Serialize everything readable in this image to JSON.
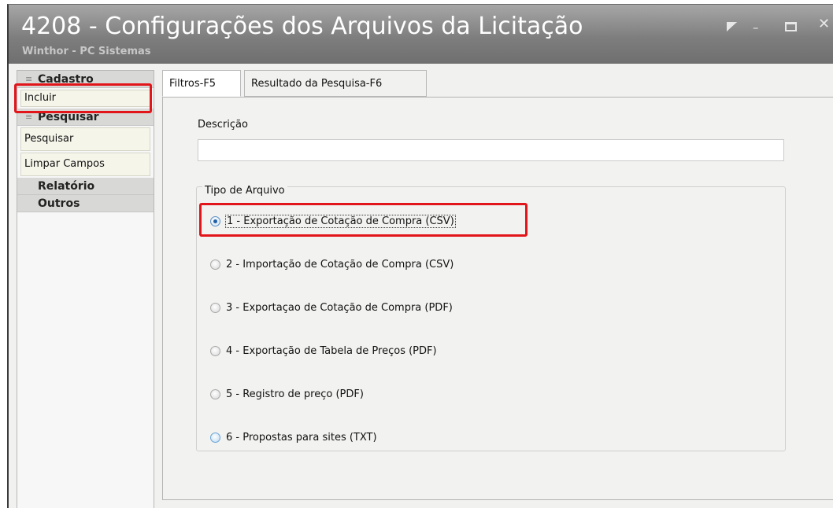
{
  "window": {
    "title": "4208 - Configurações dos Arquivos da Licitação",
    "subtitle": "Winthor - PC Sistemas"
  },
  "sidebar": {
    "groups": [
      {
        "label": "Cadastro",
        "items": [
          {
            "label": "Incluir"
          }
        ]
      },
      {
        "label": "Pesquisar",
        "items": [
          {
            "label": "Pesquisar"
          },
          {
            "label": "Limpar Campos"
          }
        ]
      },
      {
        "label": "Relatório"
      },
      {
        "label": "Outros"
      }
    ]
  },
  "tabs": [
    {
      "label": "Filtros-F5",
      "active": true
    },
    {
      "label": "Resultado da Pesquisa-F6",
      "active": false
    }
  ],
  "filters": {
    "description_label": "Descrição",
    "description_value": "",
    "file_type_label": "Tipo de Arquivo",
    "file_types": [
      {
        "label": "1 - Exportação de Cotação de Compra (CSV)",
        "selected": true
      },
      {
        "label": "2 - Importação de Cotação de Compra (CSV)",
        "selected": false
      },
      {
        "label": "3 - Exportaçao de Cotação de Compra (PDF)",
        "selected": false
      },
      {
        "label": "4 - Exportação de Tabela de Preços (PDF)",
        "selected": false
      },
      {
        "label": "5 - Registro de preço (PDF)",
        "selected": false
      },
      {
        "label": "6 - Propostas para sites (TXT)",
        "selected": false
      }
    ]
  },
  "colors": {
    "highlight": "#e2151b",
    "titlebar": "#8a8a8a"
  }
}
